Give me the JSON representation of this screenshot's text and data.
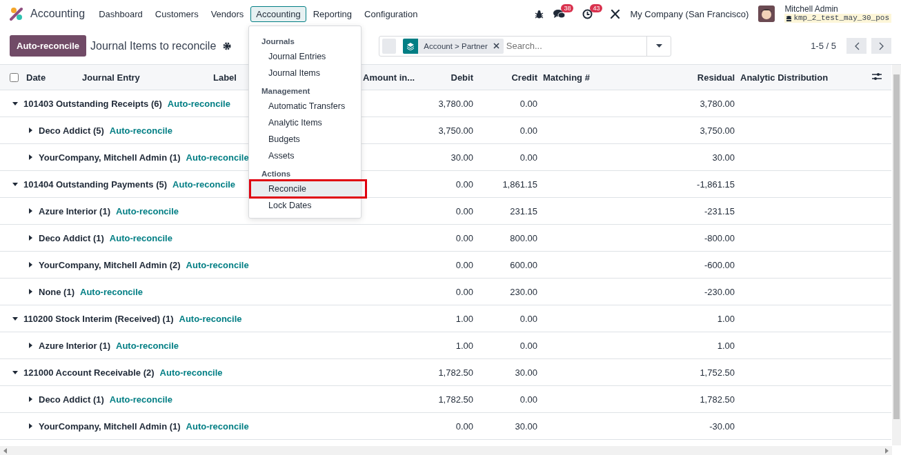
{
  "navbar": {
    "app_name": "Accounting",
    "menus": [
      {
        "label": "Dashboard",
        "selected": false
      },
      {
        "label": "Customers",
        "selected": false
      },
      {
        "label": "Vendors",
        "selected": false
      },
      {
        "label": "Accounting",
        "selected": true
      },
      {
        "label": "Reporting",
        "selected": false
      },
      {
        "label": "Configuration",
        "selected": false
      }
    ],
    "messages_badge": "38",
    "activities_badge": "43",
    "company": "My Company (San Francisco)",
    "user": "Mitchell Admin",
    "database": "kmp_2_test_may_30_pos"
  },
  "control_panel": {
    "action_button": "Auto-reconcile",
    "title": "Journal Items to reconcile",
    "facet": {
      "field": "Account",
      "separator": ">",
      "value": "Partner"
    },
    "search": {
      "placeholder": "Search..."
    },
    "pager": "1-5 / 5"
  },
  "dropdown": {
    "sections": [
      {
        "header": "Journals",
        "items": [
          {
            "label": "Journal Entries",
            "selected": false
          },
          {
            "label": "Journal Items",
            "selected": false
          }
        ]
      },
      {
        "header": "Management",
        "items": [
          {
            "label": "Automatic Transfers",
            "selected": false
          },
          {
            "label": "Analytic Items",
            "selected": false
          },
          {
            "label": "Budgets",
            "selected": false
          },
          {
            "label": "Assets",
            "selected": false
          }
        ]
      },
      {
        "header": "Actions",
        "items": [
          {
            "label": "Reconcile",
            "selected": true,
            "highlighted": true
          },
          {
            "label": "Lock Dates",
            "selected": false,
            "highlighted": false
          }
        ]
      }
    ]
  },
  "table": {
    "select_all_checked": false,
    "columns": [
      "Date",
      "Journal Entry",
      "Label",
      "Amount in...",
      "Debit",
      "Credit",
      "Matching #",
      "Residual",
      "Analytic Distribution"
    ],
    "groups": [
      {
        "name": "101403 Outstanding Receipts (6)",
        "action": "Auto-reconcile",
        "expanded": true,
        "debit": "3,780.00",
        "credit": "0.00",
        "residual": "3,780.00",
        "children": [
          {
            "name": "Deco Addict (5)",
            "action": "Auto-reconcile",
            "expanded": false,
            "debit": "3,750.00",
            "credit": "0.00",
            "residual": "3,750.00"
          },
          {
            "name": "YourCompany, Mitchell Admin (1)",
            "action": "Auto-reconcile",
            "expanded": false,
            "debit": "30.00",
            "credit": "0.00",
            "residual": "30.00"
          }
        ]
      },
      {
        "name": "101404 Outstanding Payments (5)",
        "action": "Auto-reconcile",
        "expanded": true,
        "debit": "0.00",
        "credit": "1,861.15",
        "residual": "-1,861.15",
        "children": [
          {
            "name": "Azure Interior (1)",
            "action": "Auto-reconcile",
            "expanded": false,
            "debit": "0.00",
            "credit": "231.15",
            "residual": "-231.15"
          },
          {
            "name": "Deco Addict (1)",
            "action": "Auto-reconcile",
            "expanded": false,
            "debit": "0.00",
            "credit": "800.00",
            "residual": "-800.00"
          },
          {
            "name": "YourCompany, Mitchell Admin (2)",
            "action": "Auto-reconcile",
            "expanded": false,
            "debit": "0.00",
            "credit": "600.00",
            "residual": "-600.00"
          },
          {
            "name": "None (1)",
            "action": "Auto-reconcile",
            "expanded": false,
            "debit": "0.00",
            "credit": "230.00",
            "residual": "-230.00"
          }
        ]
      },
      {
        "name": "110200 Stock Interim (Received) (1)",
        "action": "Auto-reconcile",
        "expanded": true,
        "debit": "1.00",
        "credit": "0.00",
        "residual": "1.00",
        "children": [
          {
            "name": "Azure Interior (1)",
            "action": "Auto-reconcile",
            "expanded": false,
            "debit": "1.00",
            "credit": "0.00",
            "residual": "1.00"
          }
        ]
      },
      {
        "name": "121000 Account Receivable (2)",
        "action": "Auto-reconcile",
        "expanded": true,
        "debit": "1,782.50",
        "credit": "30.00",
        "residual": "1,752.50",
        "children": [
          {
            "name": "Deco Addict (1)",
            "action": "Auto-reconcile",
            "expanded": false,
            "debit": "1,782.50",
            "credit": "0.00",
            "residual": "1,782.50"
          },
          {
            "name": "YourCompany, Mitchell Admin (1)",
            "action": "Auto-reconcile",
            "expanded": false,
            "debit": "0.00",
            "credit": "30.00",
            "residual": "-30.00"
          }
        ]
      }
    ]
  }
}
